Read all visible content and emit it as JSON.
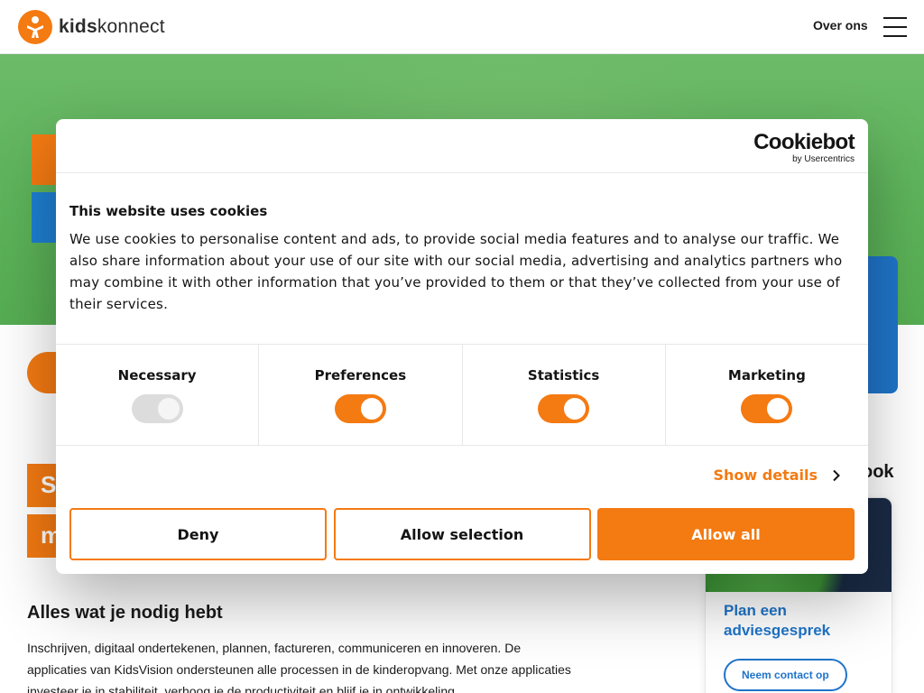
{
  "header": {
    "logo_bold": "kids",
    "logo_light": "konnect",
    "nav_link": "Over ons"
  },
  "page": {
    "title_line1": "S",
    "title_line2": "m",
    "side_heading_tail": "ook",
    "section_heading": "Alles wat je nodig hebt",
    "section_body": "Inschrijven, digitaal ondertekenen, plannen, factureren, communiceren en innoveren. De applicaties van KidsVision ondersteunen alle processen in de kinderopvang. Met onze applicaties investeer je in stabiliteit, verhoog je de productiviteit en blijf je in ontwikkeling",
    "side_card": {
      "title": "Plan een adviesgesprek",
      "button": "Neem contact op"
    }
  },
  "cookie_dialog": {
    "brand": "Cookiebot",
    "brand_sub": "by Usercentrics",
    "title": "This website uses cookies",
    "text": "We use cookies to personalise content and ads, to provide social media features and to analyse our traffic. We also share information about your use of our site with our social media, advertising and analytics partners who may combine it with other information that you’ve provided to them or that they’ve collected from your use of their services.",
    "categories": [
      {
        "label": "Necessary",
        "enabled": true,
        "locked": true
      },
      {
        "label": "Preferences",
        "enabled": true,
        "locked": false
      },
      {
        "label": "Statistics",
        "enabled": true,
        "locked": false
      },
      {
        "label": "Marketing",
        "enabled": true,
        "locked": false
      }
    ],
    "show_details": "Show details",
    "buttons": {
      "deny": "Deny",
      "allow_selection": "Allow selection",
      "allow_all": "Allow all"
    }
  },
  "colors": {
    "accent": "#f47a12",
    "blue": "#1f74c9",
    "hero_green": "#5db35a"
  }
}
